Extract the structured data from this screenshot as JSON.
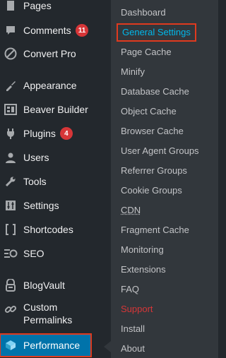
{
  "menu": {
    "pages": "Pages",
    "comments": "Comments",
    "comments_badge": "11",
    "convert_pro": "Convert Pro",
    "appearance": "Appearance",
    "beaver_builder": "Beaver Builder",
    "plugins": "Plugins",
    "plugins_badge": "4",
    "users": "Users",
    "tools": "Tools",
    "settings": "Settings",
    "shortcodes": "Shortcodes",
    "seo": "SEO",
    "blogvault": "BlogVault",
    "custom_permalinks": "Custom Permalinks",
    "performance": "Performance"
  },
  "submenu": {
    "dashboard": "Dashboard",
    "general_settings": "General Settings",
    "page_cache": "Page Cache",
    "minify": "Minify",
    "database_cache": "Database Cache",
    "object_cache": "Object Cache",
    "browser_cache": "Browser Cache",
    "user_agent_groups": "User Agent Groups",
    "referrer_groups": "Referrer Groups",
    "cookie_groups": "Cookie Groups",
    "cdn": "CDN",
    "fragment_cache": "Fragment Cache",
    "monitoring": "Monitoring",
    "extensions": "Extensions",
    "faq": "FAQ",
    "support": "Support",
    "install": "Install",
    "about": "About"
  },
  "colors": {
    "sidebar_bg": "#23282d",
    "submenu_bg": "#32373c",
    "active_bg": "#0073aa",
    "highlight_text": "#00b9eb",
    "badge": "#d63638",
    "annotation_border": "#e03a1e"
  }
}
